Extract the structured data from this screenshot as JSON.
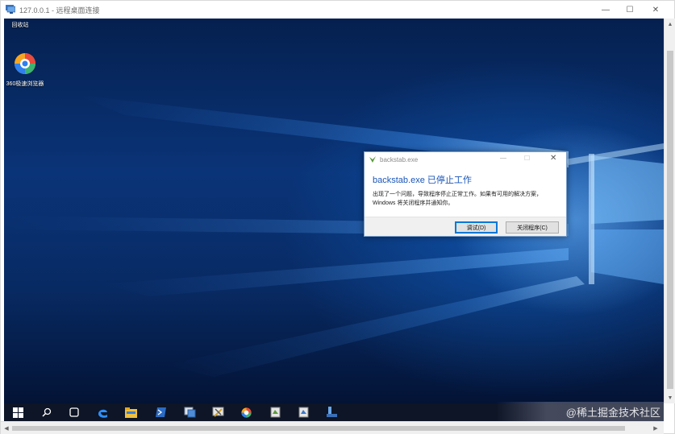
{
  "rdp_window": {
    "title": "127.0.0.1 - 远程桌面连接",
    "minimize": "—",
    "maximize": "☐",
    "close": "✕"
  },
  "desktop": {
    "icons": [
      {
        "label": "回收站",
        "icon": "recycle-bin-icon"
      },
      {
        "label": "360极速浏览器",
        "icon": "360-browser-icon"
      }
    ]
  },
  "dialog": {
    "title": "backstab.exe",
    "heading": "backstab.exe 已停止工作",
    "body": "出现了一个问题，导致程序停止正常工作。如果有可用的解决方案，Windows 将关闭程序并通知你。",
    "debug_button": "调试(D)",
    "close_button": "关闭程序(C)",
    "minimize": "—",
    "maximize": "☐",
    "close": "✕"
  },
  "taskbar": {
    "items": [
      "start-icon",
      "search-icon",
      "task-view-icon",
      "edge-icon",
      "file-explorer-icon",
      "powershell-icon",
      "app-icon-1",
      "app-icon-2",
      "360-browser-icon",
      "app-icon-3",
      "app-icon-4",
      "app-icon-5"
    ]
  },
  "watermark": "@稀土掘金技术社区",
  "colors": {
    "dialog_heading": "#1a56b8",
    "taskbar": "#0d1526",
    "desktop": "#0a3478"
  }
}
